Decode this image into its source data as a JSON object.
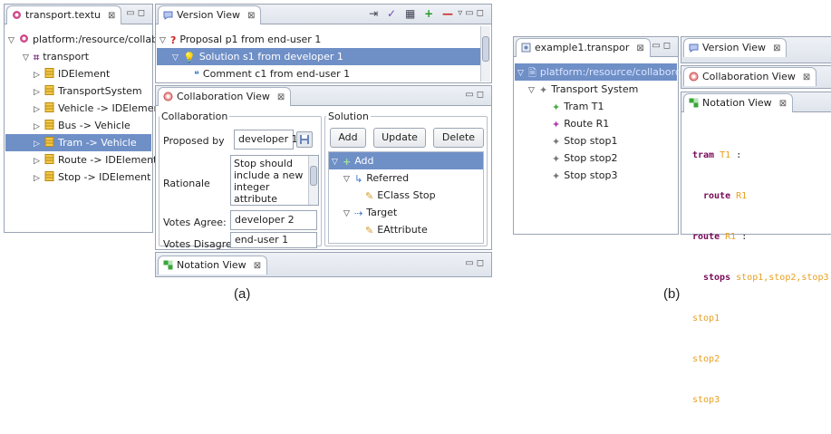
{
  "panel_a": {
    "caption": "(a)",
    "explorer": {
      "tab_label": "transport.textu",
      "items": [
        {
          "label": "platform:/resource/collabor"
        },
        {
          "label": "transport"
        },
        {
          "label": "IDElement"
        },
        {
          "label": "TransportSystem"
        },
        {
          "label": "Vehicle -> IDElement"
        },
        {
          "label": "Bus -> Vehicle"
        },
        {
          "label": "Tram -> Vehicle"
        },
        {
          "label": "Route -> IDElement"
        },
        {
          "label": "Stop -> IDElement"
        }
      ]
    },
    "version_view": {
      "tab_label": "Version View",
      "items": [
        {
          "label": "Proposal p1 from end-user 1"
        },
        {
          "label": "Solution s1 from developer 1"
        },
        {
          "label": "Comment c1 from end-user 1"
        }
      ]
    },
    "collab_view": {
      "tab_label": "Collaboration View",
      "collab_group": "Collaboration",
      "proposed_by_label": "Proposed by",
      "proposed_by_value": "developer 1",
      "rationale_label": "Rationale",
      "rationale_value": "Stop should include a new integer attribute",
      "votes_agree_label": "Votes Agree:",
      "votes_agree_value": "developer 2",
      "votes_disagree_label": "Votes Disagree",
      "votes_disagree_value": "end-user 1",
      "solution_group": "Solution",
      "add_button": "Add",
      "update_button": "Update",
      "delete_button": "Delete",
      "tree": [
        {
          "label": "Add"
        },
        {
          "label": "Referred"
        },
        {
          "label": "EClass Stop"
        },
        {
          "label": "Target"
        },
        {
          "label": "EAttribute"
        }
      ]
    },
    "notation_view": {
      "tab_label": "Notation View"
    }
  },
  "panel_b": {
    "caption": "(b)",
    "explorer": {
      "tab_label": "example1.transpor",
      "items": [
        {
          "label": "platform:/resource/collaboro.ex"
        },
        {
          "label": "Transport System"
        },
        {
          "label": "Tram T1"
        },
        {
          "label": "Route R1"
        },
        {
          "label": "Stop stop1"
        },
        {
          "label": "Stop stop2"
        },
        {
          "label": "Stop stop3"
        }
      ]
    },
    "version_tab": "Version View",
    "collab_tab": "Collaboration View",
    "notation_tab": "Notation View",
    "code": {
      "l1_kw": "tram",
      "l1_id": "T1",
      "l1_colon": ":",
      "l2_kw": "route",
      "l2_id": "R1",
      "l3_kw": "route",
      "l3_id": "R1",
      "l3_colon": ":",
      "l4_kw": "stops",
      "l4_val": "stop1,stop2,stop3",
      "l5": "stop1",
      "l6": "stop2",
      "l7": "stop3"
    }
  },
  "colors": {
    "selection": "#6f8fc7",
    "keyword": "#7a0a5a",
    "value": "#e8a020"
  }
}
